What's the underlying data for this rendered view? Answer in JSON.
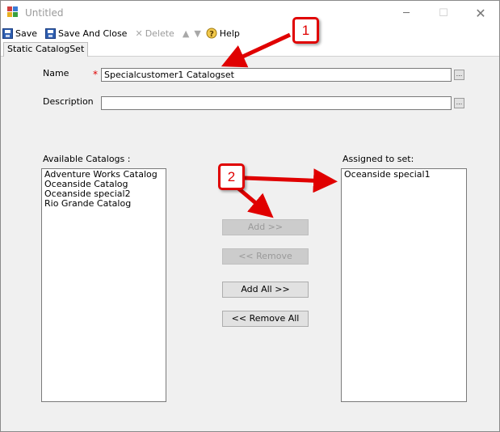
{
  "window": {
    "title": "Untitled",
    "minimize_glyph": "─",
    "maximize_glyph": "☐",
    "close_glyph": "✕"
  },
  "toolbar": {
    "save_label": "Save",
    "save_close_label": "Save And Close",
    "delete_label": "Delete",
    "help_label": "Help",
    "icons": [
      "save-icon",
      "save-close-icon",
      "delete-icon",
      "move-up-icon",
      "move-down-icon",
      "help-icon"
    ]
  },
  "tab": {
    "label": "Static CatalogSet"
  },
  "form": {
    "name_label": "Name",
    "required_mark": "*",
    "name_value": "Specialcustomer1 Catalogset",
    "description_label": "Description",
    "description_value": "",
    "ellipsis_label": "..."
  },
  "available": {
    "label": "Available Catalogs :",
    "items": [
      "Adventure Works Catalog",
      "Oceanside Catalog",
      "Oceanside special2",
      "Rio Grande Catalog"
    ]
  },
  "assigned": {
    "label": "Assigned to set:",
    "items": [
      "Oceanside special1"
    ]
  },
  "buttons": {
    "add": "Add >>",
    "remove": "<< Remove",
    "add_all": "Add All >>",
    "remove_all": "<< Remove All"
  },
  "callouts": {
    "one": "1",
    "two": "2"
  },
  "colors": {
    "annotation": "#e00000",
    "window_bg": "#f0f0f0"
  }
}
